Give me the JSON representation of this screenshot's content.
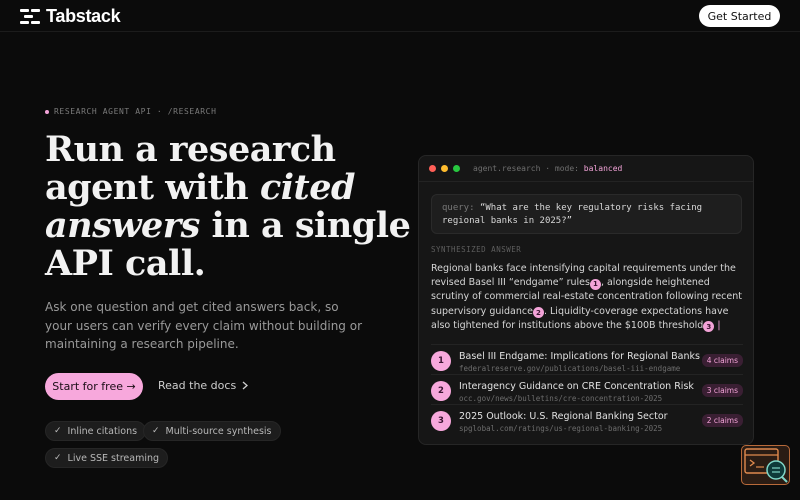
{
  "header": {
    "brand": "Tabstack",
    "cta": "Get Started"
  },
  "hero": {
    "eyebrow": "RESEARCH AGENT API · /RESEARCH",
    "headline_part1": "Run a research agent with ",
    "headline_em1": "cited answers",
    "headline_part2": " in a single API call.",
    "subcopy": "Ask one question and get cited answers back, so your users can verify every claim without building or maintaining a research pipeline.",
    "primary_cta": "Start for free →",
    "secondary_cta": "Read the docs",
    "features": [
      "Inline citations",
      "Multi-source synthesis",
      "Live SSE streaming"
    ]
  },
  "terminal": {
    "title": "agent.research · mode:",
    "mode": "balanced",
    "query_key": "query:",
    "query_text": "“What are the key regulatory risks facing regional banks in 2025?”",
    "section_label": "SYNTHESIZED ANSWER",
    "answer_1": "Regional banks face intensifying capital requirements under the revised Basel III “endgame” rules",
    "answer_2": ", alongside heightened scrutiny of commercial real-estate concentration following recent supervisory guidance",
    "answer_3": ". Liquidity-coverage expectations have also tightened for institutions above the $100B threshold",
    "sources": [
      {
        "num": "1",
        "title": "Basel III Endgame: Implications for Regional Banks",
        "url": "federalreserve.gov/publications/basel-iii-endgame",
        "claims": "4 claims"
      },
      {
        "num": "2",
        "title": "Interagency Guidance on CRE Concentration Risk",
        "url": "occ.gov/news/bulletins/cre-concentration-2025",
        "claims": "3 claims"
      },
      {
        "num": "3",
        "title": "2025 Outlook: U.S. Regional Banking Sector",
        "url": "spglobal.com/ratings/us-regional-banking-2025",
        "claims": "2 claims"
      }
    ]
  },
  "colors": {
    "accent": "#f7a8dc",
    "background": "#0b0b0b"
  }
}
